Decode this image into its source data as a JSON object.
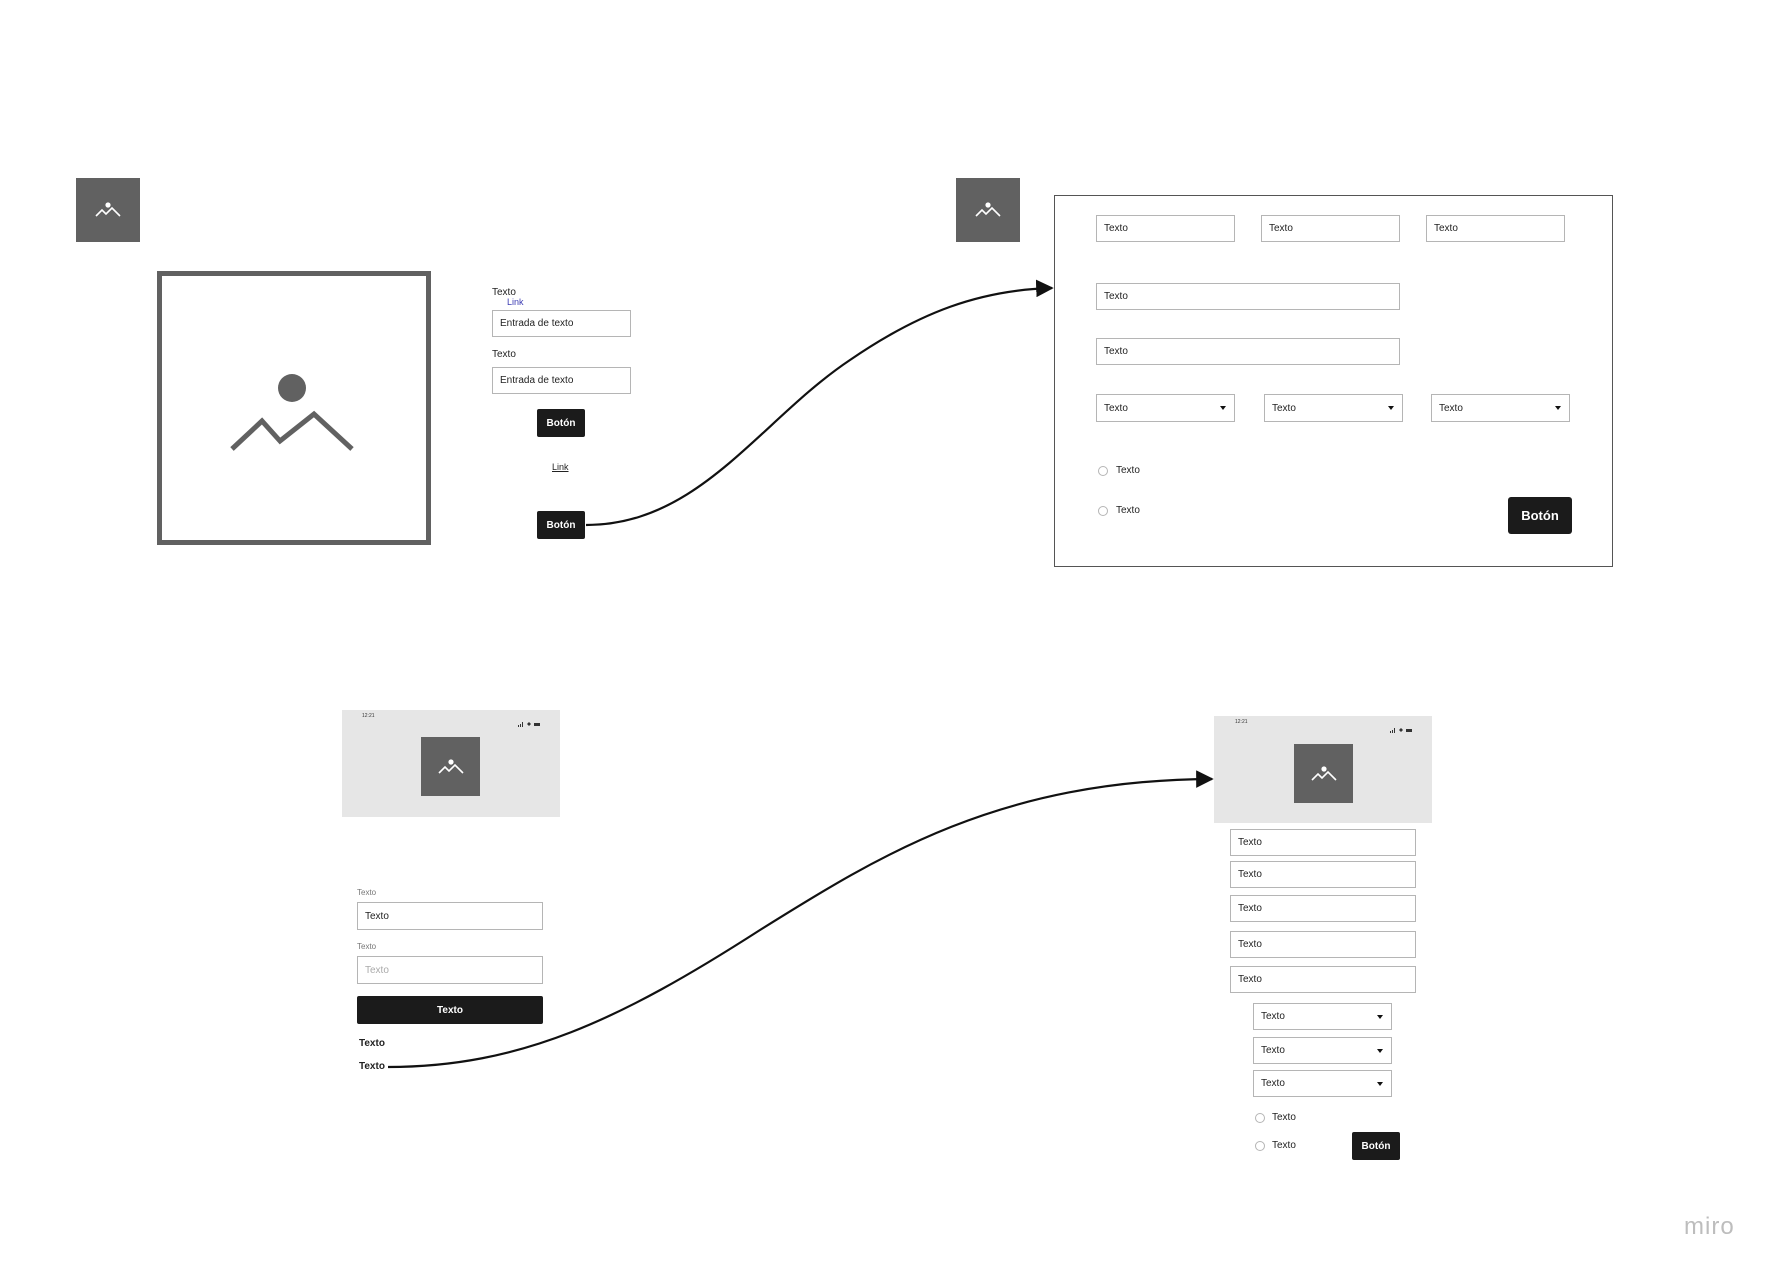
{
  "colors": {
    "placeholder": "#616161",
    "button": "#1b1b1b",
    "phone_header": "#e6e6e6",
    "link": "#3b3bb3"
  },
  "top_left": {
    "small_image_icon": "image-icon",
    "large_image_icon": "image-icon",
    "form": {
      "label1": "Texto",
      "link1": "Link",
      "input1": "Entrada de texto",
      "label2": "Texto",
      "input2": "Entrada de texto",
      "button1": "Botón",
      "link2": "Link",
      "button2": "Botón"
    }
  },
  "top_right": {
    "small_image_icon": "image-icon",
    "fields_row1": [
      "Texto",
      "Texto",
      "Texto"
    ],
    "field_wide1": "Texto",
    "field_wide2": "Texto",
    "selects": [
      "Texto",
      "Texto",
      "Texto"
    ],
    "radio1": "Texto",
    "radio2": "Texto",
    "button": "Botón"
  },
  "bottom_left": {
    "status_time": "12:21",
    "label1": "Texto",
    "input1": "Texto",
    "label2": "Texto",
    "input2_placeholder": "Texto",
    "button": "Texto",
    "text1": "Texto",
    "text2": "Texto"
  },
  "bottom_right": {
    "status_time": "12:21",
    "fields": [
      "Texto",
      "Texto",
      "Texto",
      "Texto",
      "Texto"
    ],
    "selects": [
      "Texto",
      "Texto",
      "Texto"
    ],
    "radio1": "Texto",
    "radio2": "Texto",
    "button": "Botón"
  },
  "watermark": "miro"
}
